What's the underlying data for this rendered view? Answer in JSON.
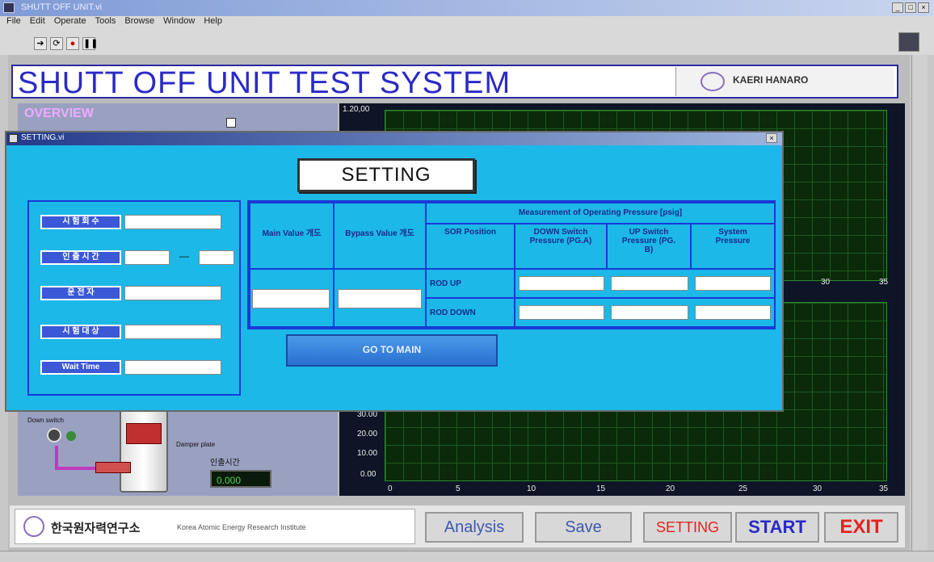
{
  "window": {
    "title": "SHUTT OFF UNIT.vi",
    "menu": [
      "File",
      "Edit",
      "Operate",
      "Tools",
      "Browse",
      "Window",
      "Help"
    ]
  },
  "toolbar": {
    "run_icon": "run-arrow-icon",
    "run_cont_icon": "run-continuous-icon",
    "stop_icon": "abort-icon",
    "pause_icon": "pause-icon"
  },
  "headline": {
    "title": "SHUTT OFF UNIT TEST SYSTEM",
    "logo_text": "KAERI HANARO"
  },
  "overview": {
    "title": "OVERVIEW",
    "switch_label": "Down switch",
    "damper_label": "Damper plate",
    "korean_label": "인출시간",
    "value": "0.000"
  },
  "chart": {
    "y_ticks": [
      "1.20,00",
      "30.00",
      "20.00",
      "10.00",
      "0.00"
    ],
    "x_ticks": [
      "0",
      "5",
      "10",
      "15",
      "20",
      "25",
      "30",
      "35"
    ],
    "top_ticks": [
      "30",
      "35"
    ]
  },
  "dialog": {
    "title": "SETTING.vi",
    "heading": "SETTING",
    "left_labels": [
      "시 험 회 수",
      "인 출 시 간",
      "운 전 자",
      "시 험 대 상",
      "Wait Time"
    ],
    "left_dash": "—",
    "table": {
      "col_main": "Main Value 개도",
      "col_bypass": "Bypass Value 개도",
      "group_header": "Measurement of Operating Pressure [psig]",
      "col_sor": "SOR Position",
      "col_down": "DOWN Switch Pressure (PG.A)",
      "col_up": "UP Switch Pressure (PG. B)",
      "col_sys": "System Pressure",
      "row_up": "ROD UP",
      "row_down": "ROD DOWN"
    },
    "goto_main": "GO TO MAIN"
  },
  "bottom": {
    "org_kr": "한국원자력연구소",
    "org_en": "Korea Atomic Energy Research Institute",
    "analysis": "Analysis",
    "save": "Save",
    "setting": "SETTING",
    "start": "START",
    "exit": "EXIT"
  },
  "colors": {
    "accent": "#2a2ac8",
    "dialog_bg": "#1bb8e8",
    "red": "#e82020"
  }
}
